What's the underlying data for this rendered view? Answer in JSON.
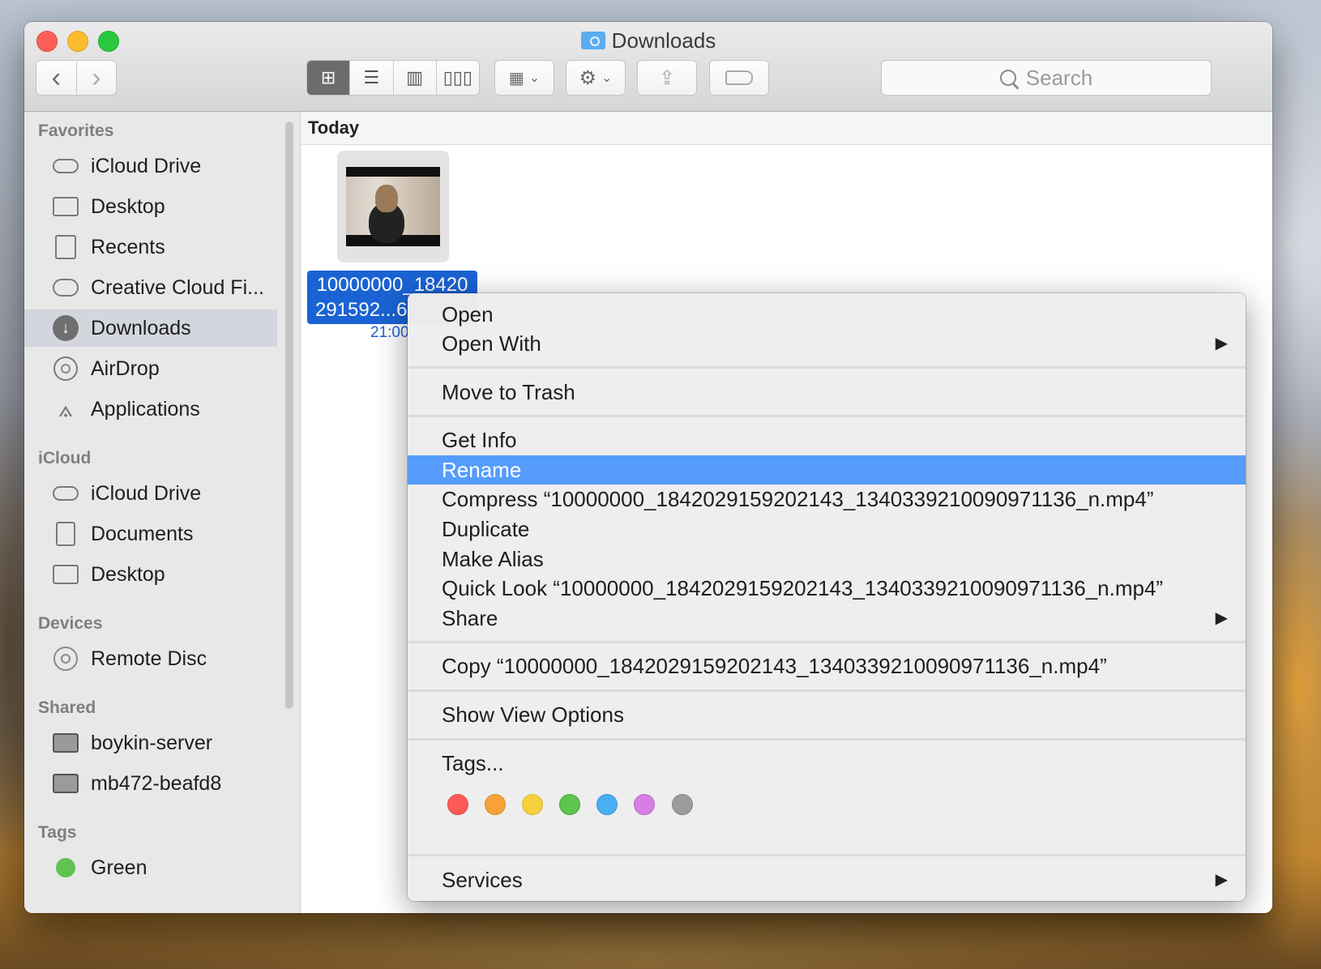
{
  "window": {
    "title": "Downloads"
  },
  "search": {
    "placeholder": "Search"
  },
  "sidebar": {
    "sections": [
      {
        "label": "Favorites"
      },
      {
        "label": "iCloud"
      },
      {
        "label": "Devices"
      },
      {
        "label": "Shared"
      },
      {
        "label": "Tags"
      }
    ],
    "items": [
      {
        "label": "iCloud Drive",
        "icon": "cloud-icon"
      },
      {
        "label": "Desktop",
        "icon": "desktop-icon"
      },
      {
        "label": "Recents",
        "icon": "recents-icon"
      },
      {
        "label": "Creative Cloud Fi...",
        "icon": "creative-cloud-icon"
      },
      {
        "label": "Downloads",
        "icon": "downloads-icon",
        "active": true
      },
      {
        "label": "AirDrop",
        "icon": "airdrop-icon"
      },
      {
        "label": "Applications",
        "icon": "applications-icon"
      },
      {
        "label": "iCloud Drive",
        "icon": "cloud-icon"
      },
      {
        "label": "Documents",
        "icon": "documents-icon"
      },
      {
        "label": "Desktop",
        "icon": "desktop-icon"
      },
      {
        "label": "Remote Disc",
        "icon": "disc-icon"
      },
      {
        "label": "boykin-server",
        "icon": "computer-icon"
      },
      {
        "label": "mb472-beafd8",
        "icon": "computer-icon"
      },
      {
        "label": "Green",
        "icon": "green-tag-icon",
        "color": "#5ec34f"
      }
    ]
  },
  "content": {
    "section_header": "Today",
    "file": {
      "name_line1": "10000000_18420",
      "name_line2": "291592...6",
      "time": "21:00"
    }
  },
  "context_menu": {
    "items": {
      "open": "Open",
      "open_with": "Open With",
      "move_to_trash": "Move to Trash",
      "get_info": "Get Info",
      "rename": "Rename",
      "compress": "Compress “10000000_1842029159202143_1340339210090971136_n.mp4”",
      "duplicate": "Duplicate",
      "make_alias": "Make Alias",
      "quick_look": "Quick Look “10000000_1842029159202143_1340339210090971136_n.mp4”",
      "share": "Share",
      "copy": "Copy “10000000_1842029159202143_1340339210090971136_n.mp4”",
      "show_view_options": "Show View Options",
      "tags": "Tags...",
      "services": "Services"
    },
    "highlighted": "Rename",
    "tag_colors": [
      "#fc5b57",
      "#f7a139",
      "#f6cf3e",
      "#5ec34f",
      "#4aaef3",
      "#d57fe4",
      "#9b9b9b"
    ]
  }
}
